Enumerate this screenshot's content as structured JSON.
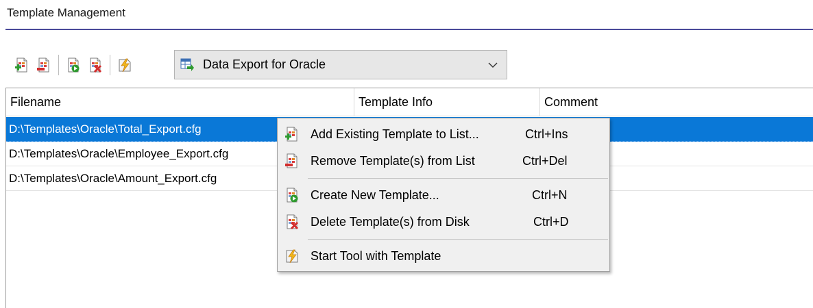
{
  "section": {
    "title": "Template Management"
  },
  "toolbar": {
    "buttons": [
      {
        "icon": "add-template-icon"
      },
      {
        "icon": "remove-template-icon"
      },
      {
        "icon": "create-template-icon"
      },
      {
        "icon": "delete-template-icon"
      },
      {
        "icon": "start-tool-icon"
      }
    ],
    "tool_select": {
      "icon": "data-export-icon",
      "value": "Data Export for Oracle"
    }
  },
  "grid": {
    "columns": [
      "Filename",
      "Template Info",
      "Comment"
    ],
    "rows": [
      {
        "filename": "D:\\Templates\\Oracle\\Total_Export.cfg",
        "selected": true
      },
      {
        "filename": "D:\\Templates\\Oracle\\Employee_Export.cfg",
        "selected": false
      },
      {
        "filename": "D:\\Templates\\Oracle\\Amount_Export.cfg",
        "selected": false
      }
    ]
  },
  "context_menu": {
    "items": [
      {
        "label": "Add Existing Template to List...",
        "shortcut": "Ctrl+Ins",
        "icon": "add-template-icon"
      },
      {
        "label": "Remove Template(s) from List",
        "shortcut": "Ctrl+Del",
        "icon": "remove-template-icon"
      },
      {
        "label": "Create New Template...",
        "shortcut": "Ctrl+N",
        "icon": "create-template-icon"
      },
      {
        "label": "Delete Template(s) from Disk",
        "shortcut": "Ctrl+D",
        "icon": "delete-template-icon"
      },
      {
        "label": "Start Tool with Template",
        "shortcut": "",
        "icon": "start-tool-icon"
      }
    ]
  },
  "colors": {
    "selection": "#0a78d7",
    "accent_rule": "#4a4a9a",
    "menu_bg": "#f0f0f0"
  }
}
